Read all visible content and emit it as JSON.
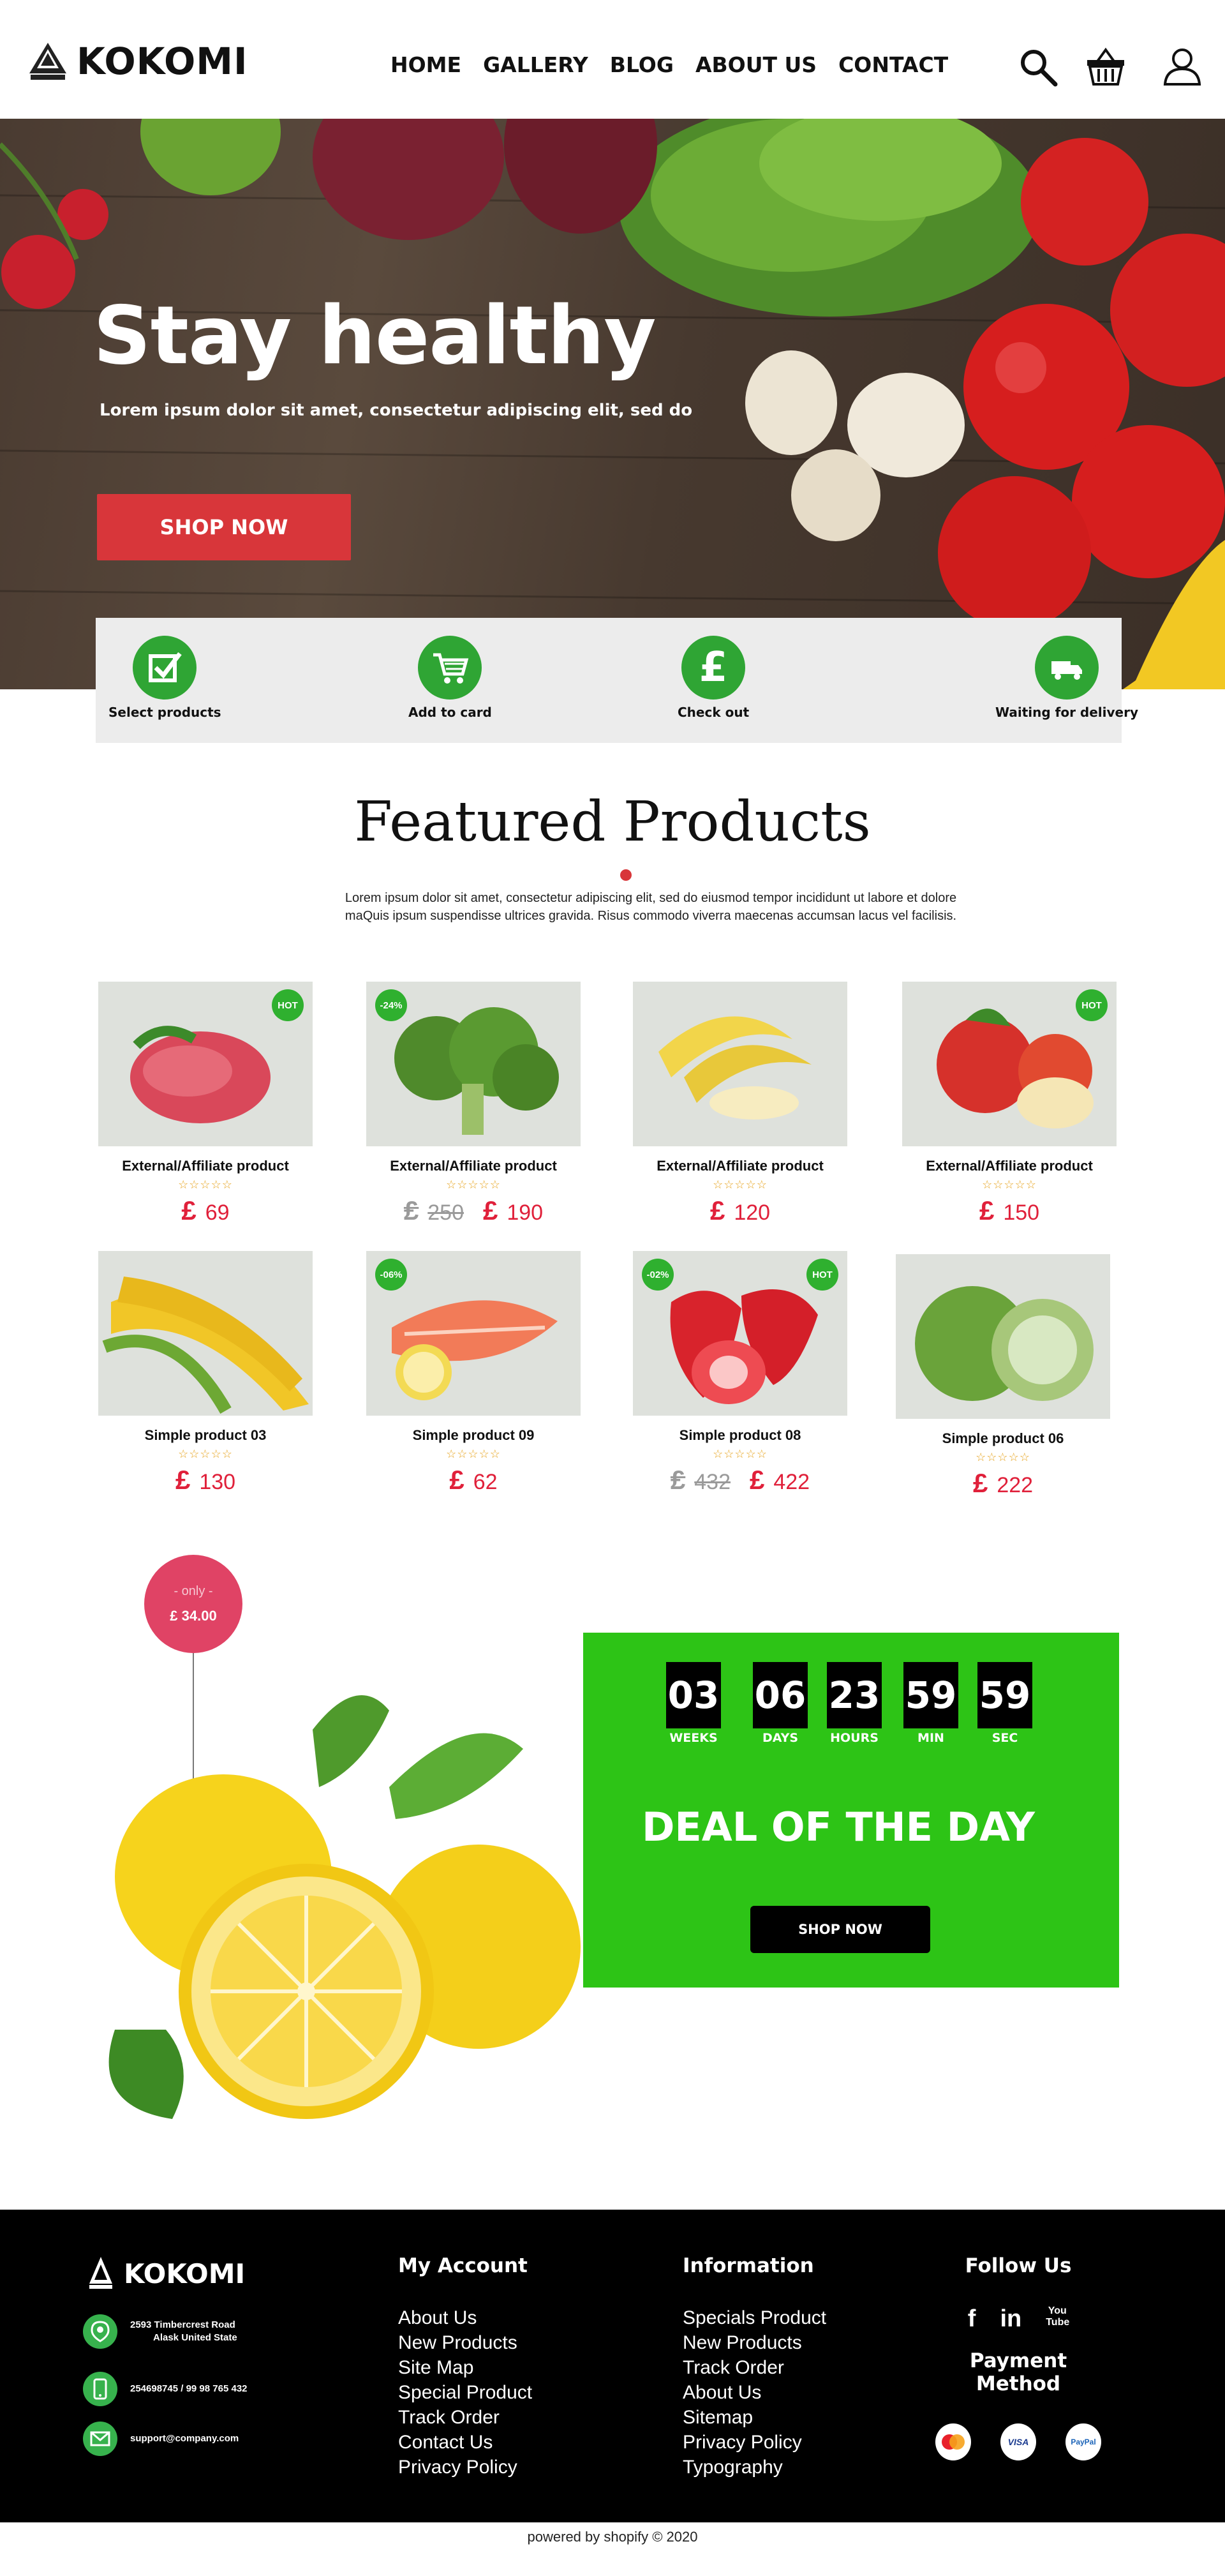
{
  "header": {
    "logo_text": "KOKOMI",
    "logo_mark_text": "KOKOMI",
    "nav": [
      "HOME",
      "GALLERY",
      "BLOG",
      "ABOUT US",
      "CONTACT"
    ],
    "icons": [
      "search-icon",
      "basket-icon",
      "user-icon"
    ]
  },
  "hero": {
    "title": "Stay healthy",
    "subtitle": "Lorem ipsum dolor sit amet, consectetur adipiscing elit, sed do",
    "button": "SHOP NOW"
  },
  "steps": [
    {
      "label": "Select products",
      "icon": "checkbox-icon"
    },
    {
      "label": "Add to card",
      "icon": "cart-icon"
    },
    {
      "label": "Check out",
      "icon": "pound-icon"
    },
    {
      "label": "Waiting for delivery",
      "icon": "truck-icon"
    }
  ],
  "featured": {
    "title": "Featured Products",
    "description_line1": "Lorem ipsum dolor sit amet, consectetur adipiscing elit, sed do eiusmod tempor incididunt ut labore et dolore",
    "description_line2": "maQuis ipsum suspendisse ultrices gravida. Risus commodo viverra maecenas accumsan lacus vel facilisis."
  },
  "currency_symbol": "£",
  "stars": "☆☆☆☆☆",
  "products": [
    {
      "title": "External/Affiliate product",
      "price": "69",
      "old_price": "",
      "badge": "HOT",
      "image": "meat"
    },
    {
      "title": "External/Affiliate product",
      "price": "190",
      "old_price": "250",
      "badge": "-24%",
      "image": "broccoli"
    },
    {
      "title": "External/Affiliate product",
      "price": "120",
      "old_price": "",
      "badge": "",
      "image": "banana"
    },
    {
      "title": "External/Affiliate product",
      "price": "150",
      "old_price": "",
      "badge": "HOT",
      "image": "apple"
    },
    {
      "title": "Simple product  03",
      "price": "130",
      "old_price": "",
      "badge": "",
      "image": "corn"
    },
    {
      "title": "Simple product 09",
      "price": "62",
      "old_price": "",
      "badge": "-06%",
      "image": "salmon"
    },
    {
      "title": "Simple product 08",
      "price": "422",
      "old_price": "432",
      "badge": "-02%",
      "badge2": "HOT",
      "image": "strawberry"
    },
    {
      "title": "Simple product  06",
      "price": "222",
      "old_price": "",
      "badge": "",
      "image": "cabbage"
    }
  ],
  "deal": {
    "only_label": "- only -",
    "only_price": "£ 34.00",
    "countdown": [
      {
        "value": "03",
        "label": "WEEKS"
      },
      {
        "value": "06",
        "label": "DAYS"
      },
      {
        "value": "23",
        "label": "HOURS"
      },
      {
        "value": "59",
        "label": "MIN"
      },
      {
        "value": "59",
        "label": "SEC"
      }
    ],
    "title": "DEAL OF THE DAY",
    "button": "SHOP NOW"
  },
  "footer": {
    "logo_text": "KOKOMI",
    "address_line1": "2593 Timbercrest Road",
    "address_line2": "Alask United State",
    "phone": "254698745 / 99 98 765 432",
    "email": "support@company.com",
    "my_account_title": "My Account",
    "my_account_links": [
      "About Us",
      "New Products",
      "Site Map",
      "Special Product",
      "Track Order",
      "Contact Us",
      "Privacy Policy"
    ],
    "information_title": "Information",
    "information_links": [
      "Specials Product",
      "New Products",
      "Track Order",
      "About Us",
      "Sitemap",
      "Privacy Policy",
      "Typography"
    ],
    "follow_title": "Follow Us",
    "social": [
      "f",
      "in",
      "You Tube"
    ],
    "payment_title": "Payment Method",
    "payments": [
      "mastercard",
      "VISA",
      "PayPal"
    ]
  },
  "copyright": "powered by shopify  © 2020",
  "colors": {
    "accent_red": "#d8363a",
    "price_red": "#e0203a",
    "green": "#2fa534",
    "deal_green": "#2dc416",
    "pink": "#e04365"
  }
}
